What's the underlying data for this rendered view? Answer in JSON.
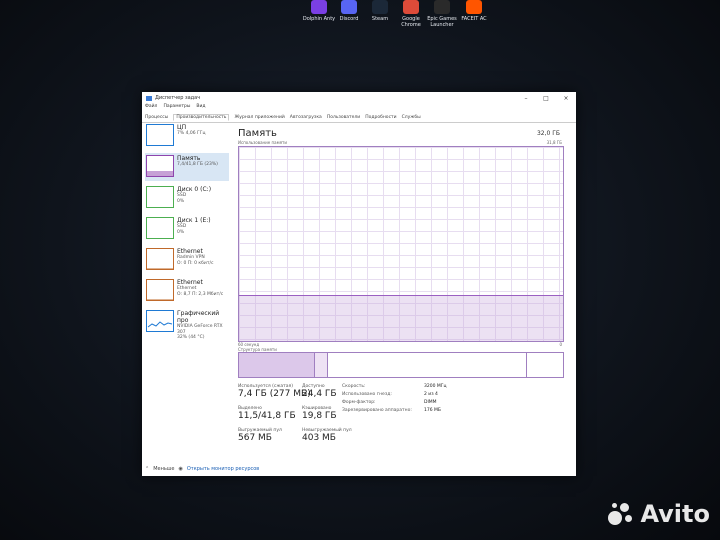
{
  "desktop_icons": [
    {
      "label": "Dolphin Anty",
      "color": "#7b3fe4"
    },
    {
      "label": "Discord",
      "color": "#5865f2"
    },
    {
      "label": "Steam",
      "color": "#1b2838"
    },
    {
      "label": "Google Chrome",
      "color": "#dd4b39"
    },
    {
      "label": "Epic Games Launcher",
      "color": "#2a2a2a"
    },
    {
      "label": "FACEIT AC",
      "color": "#ff5500"
    }
  ],
  "window": {
    "title": "Диспетчер задач",
    "controls": {
      "minimize": "–",
      "maximize": "□",
      "close": "×"
    },
    "menu": [
      "Файл",
      "Параметры",
      "Вид"
    ],
    "tabs": [
      "Процессы",
      "Производительность",
      "Журнал приложений",
      "Автозагрузка",
      "Пользователи",
      "Подробности",
      "Службы"
    ],
    "active_tab": "Производительность"
  },
  "sidebar": [
    {
      "title": "ЦП",
      "line1": "7% 4,06 ГГц",
      "line2": "",
      "accent": "#1f7ad4"
    },
    {
      "title": "Память",
      "line1": "7,4/41,8 ГБ (23%)",
      "line2": "",
      "accent": "#8e44ad"
    },
    {
      "title": "Диск 0 (C:)",
      "line1": "SSD",
      "line2": "0%",
      "accent": "#4caf50"
    },
    {
      "title": "Диск 1 (E:)",
      "line1": "SSD",
      "line2": "0%",
      "accent": "#4caf50"
    },
    {
      "title": "Ethernet",
      "line1": "Radmin VPN",
      "line2": "О: 0 П: 0 кбит/с",
      "accent": "#c0692a"
    },
    {
      "title": "Ethernet",
      "line1": "Ethernet",
      "line2": "О: 8,7 П: 2,3 Мбит/с",
      "accent": "#c0692a"
    },
    {
      "title": "Графический про",
      "line1": "NVIDIA GeForce RTX 307",
      "line2": "32% (44 °C)",
      "accent": "#1f7ad4"
    }
  ],
  "main": {
    "title": "Память",
    "total": "32,0 ГБ",
    "graph_caption": "Использование памяти",
    "graph_max": "31,8 ГБ",
    "time_label": "60 секунд",
    "time_end": "0",
    "used_fraction": 0.23,
    "comp_caption": "Структура памяти",
    "stats": {
      "in_use_label": "Используется (сжатая)",
      "in_use": "7,4 ГБ (277 МБ)",
      "available_label": "Доступно",
      "available": "24,4 ГБ",
      "committed_label": "Выделено",
      "committed": "11,5/41,8 ГБ",
      "cached_label": "Кэшировано",
      "cached": "19,8 ГБ",
      "paged_label": "Выгружаемый пул",
      "paged": "567 МБ",
      "nonpaged_label": "Невыгружаемый пул",
      "nonpaged": "403 МБ"
    },
    "details": [
      {
        "k": "Скорость:",
        "v": "3200 МГц"
      },
      {
        "k": "Использовано гнезд:",
        "v": "2 из 4"
      },
      {
        "k": "Форм-фактор:",
        "v": "DIMM"
      },
      {
        "k": "Зарезервировано аппаратно:",
        "v": "176 МБ"
      }
    ]
  },
  "footer": {
    "less": "Меньше",
    "monitor": "Открыть монитор ресурсов"
  },
  "watermark": "Avito"
}
